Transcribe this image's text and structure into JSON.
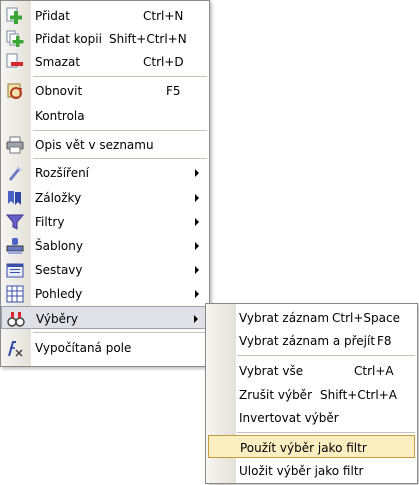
{
  "main_menu": {
    "items": [
      {
        "label": "Přidat",
        "shortcut": "Ctrl+N",
        "icon": "add-icon"
      },
      {
        "label": "Přidat kopii",
        "shortcut": "Shift+Ctrl+N",
        "icon": "add-copy-icon"
      },
      {
        "label": "Smazat",
        "shortcut": "Ctrl+D",
        "icon": "delete-icon"
      },
      {
        "label": "Obnovit",
        "shortcut": "F5",
        "icon": "refresh-icon"
      },
      {
        "label": "Kontrola",
        "shortcut": "",
        "icon": ""
      },
      {
        "label": "Opis vět v seznamu",
        "shortcut": "",
        "icon": "print-icon"
      },
      {
        "label": "Rozšíření",
        "icon": "extension-icon"
      },
      {
        "label": "Záložky",
        "icon": "bookmarks-icon"
      },
      {
        "label": "Filtry",
        "icon": "filter-icon"
      },
      {
        "label": "Šablony",
        "icon": "template-icon"
      },
      {
        "label": "Sestavy",
        "icon": "reports-icon"
      },
      {
        "label": "Pohledy",
        "icon": "views-icon"
      },
      {
        "label": "Výběry",
        "icon": "selection-icon"
      },
      {
        "label": "Vypočítaná pole",
        "icon": "calculated-fields-icon"
      }
    ]
  },
  "sub_menu": {
    "items": [
      {
        "label": "Vybrat záznam",
        "shortcut": "Ctrl+Space"
      },
      {
        "label": "Vybrat záznam a přejít",
        "shortcut": "F8"
      },
      {
        "label": "Vybrat vše",
        "shortcut": "Ctrl+A"
      },
      {
        "label": "Zrušit výběr",
        "shortcut": "Shift+Ctrl+A"
      },
      {
        "label": "Invertovat výběr",
        "shortcut": ""
      },
      {
        "label": "Použít výběr jako filtr",
        "shortcut": ""
      },
      {
        "label": "Uložit výběr jako filtr",
        "shortcut": ""
      }
    ]
  },
  "colors": {
    "highlight": "#dfe1e6",
    "selected": "#fbefc2",
    "gutter": "#e4e1d8"
  }
}
